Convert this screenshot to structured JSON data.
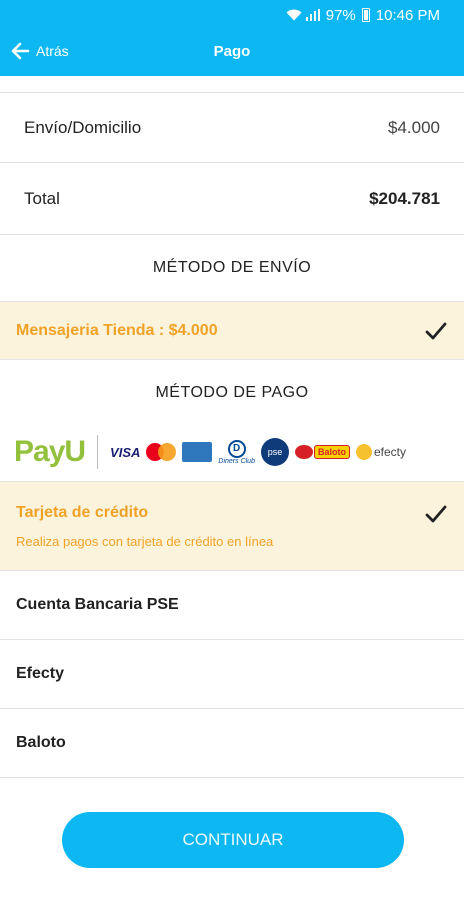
{
  "status_bar": {
    "battery": "97%",
    "time": "10:46 PM"
  },
  "app_bar": {
    "back_label": "Atrás",
    "title": "Pago"
  },
  "summary": {
    "shipping_label": "Envío/Domicilio",
    "shipping_value": "$4.000",
    "total_label": "Total",
    "total_value": "$204.781"
  },
  "shipping_method": {
    "title": "MÉTODO DE ENVÍO",
    "option_label": "Mensajeria Tienda : $4.000"
  },
  "payment_method": {
    "title": "MÉTODO DE PAGO",
    "logos": {
      "payu": "PayU",
      "visa": "VISA",
      "diners": "Diners Club",
      "pse": "pse",
      "baloto": "Baloto",
      "efecty": "efecty"
    },
    "selected": {
      "label": "Tarjeta de crédito",
      "description": "Realiza pagos con tarjeta de crédito en línea"
    },
    "options": [
      "Cuenta Bancaria PSE",
      "Efecty",
      "Baloto"
    ]
  },
  "continue_button": "CONTINUAR",
  "colors": {
    "primary": "#0db7f1",
    "accent": "#f0a227",
    "selected_bg": "#fcf3dc"
  }
}
